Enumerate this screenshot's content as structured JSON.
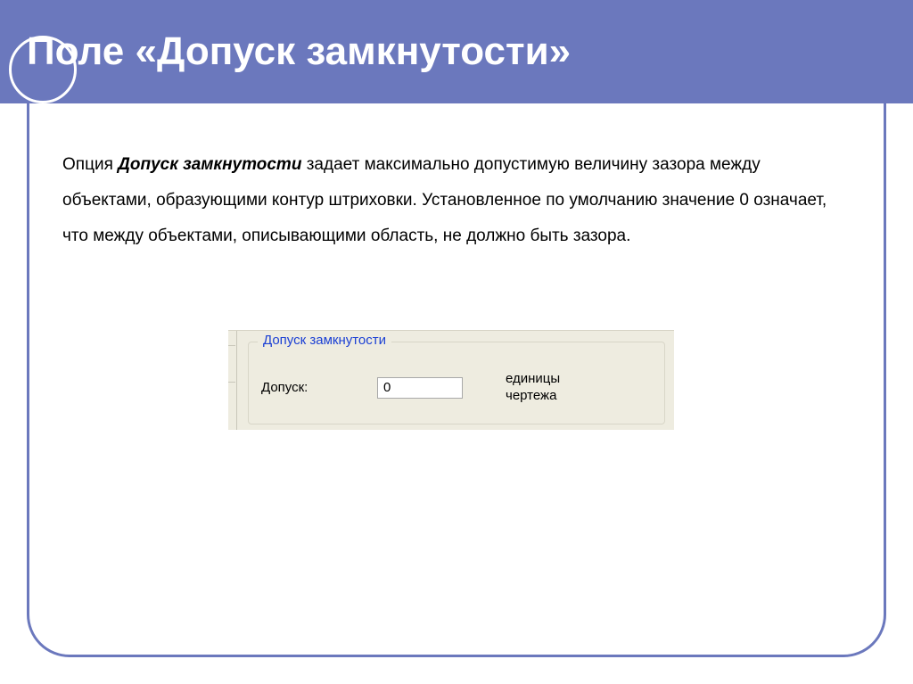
{
  "slide": {
    "title": "Поле «Допуск замкнутости»",
    "para_prefix": "Опция ",
    "para_option": "Допуск замкнутости",
    "para_rest": " задает максимально допустимую величину зазора между объектами, образующими контур штриховки. Установленное по умолчанию значение 0 означает, что между объектами, описывающими область, не должно быть зазора."
  },
  "widget": {
    "legend": "Допуск замкнутости",
    "label": "Допуск:",
    "value": "0",
    "units_line1": "единицы",
    "units_line2": "чертежа"
  }
}
